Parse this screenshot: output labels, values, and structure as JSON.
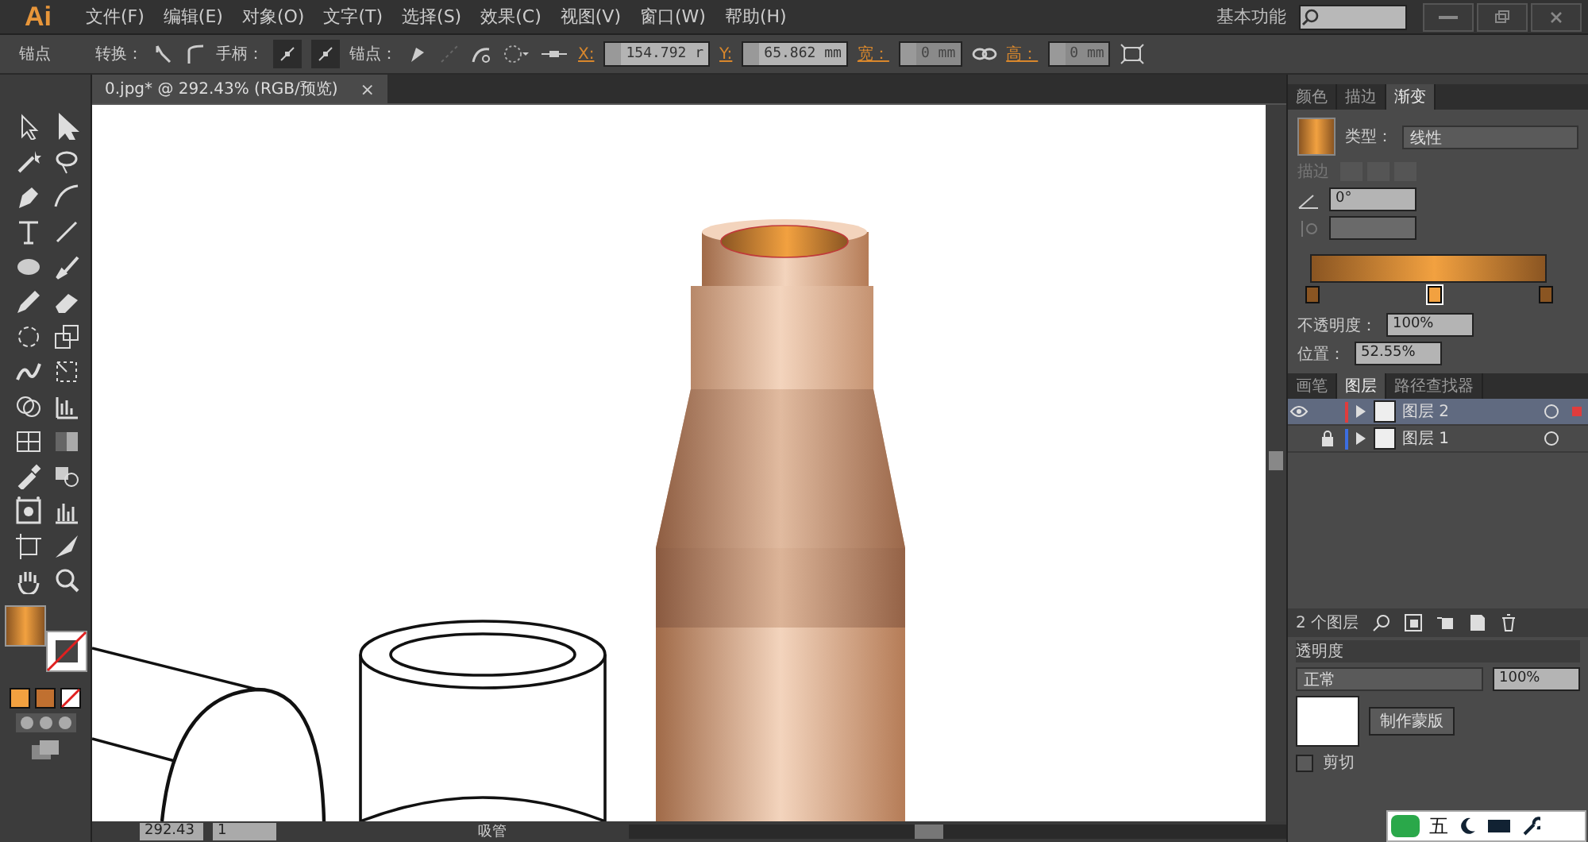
{
  "app": {
    "logo": "Ai",
    "workspace": "基本功能"
  },
  "menu": [
    "文件(F)",
    "编辑(E)",
    "对象(O)",
    "文字(T)",
    "选择(S)",
    "效果(C)",
    "视图(V)",
    "窗口(W)",
    "帮助(H)"
  ],
  "control_bar": {
    "label": "锚点",
    "convert_label": "转换：",
    "handles_label": "手柄：",
    "anchor_label": "锚点：",
    "x_label": "X:",
    "x_value": "154.792 r",
    "y_label": "Y:",
    "y_value": "65.862 mm",
    "w_label": "宽：",
    "w_value": "0 mm",
    "h_label": "高：",
    "h_value": "0 mm"
  },
  "document_tab": {
    "title": "0.jpg* @ 292.43% (RGB/预览)",
    "close": "×"
  },
  "status_bar": {
    "zoom": "292.43",
    "page": "1",
    "tool": "吸管"
  },
  "gradient_panel": {
    "tabs": [
      {
        "label": "颜色",
        "selected": false
      },
      {
        "label": "描边",
        "selected": false
      },
      {
        "label": "渐变",
        "selected": true
      }
    ],
    "type_label": "类型：",
    "type_value": "线性",
    "stroke_label": "描边",
    "angle_value": "0°",
    "stops": [
      {
        "level": 0,
        "color": "#8a5522",
        "selected": false
      },
      {
        "level": 0.5255,
        "color": "#f2a140",
        "selected": true
      },
      {
        "level": 1,
        "color": "#8a5522",
        "selected": false
      }
    ],
    "opacity_label": "不透明度：",
    "opacity_value": "100%",
    "position_label": "位置：",
    "position_value": "52.55%"
  },
  "layers_panel": {
    "tabs": [
      {
        "label": "画笔",
        "selected": false
      },
      {
        "label": "图层",
        "selected": true
      },
      {
        "label": "路径查找器",
        "selected": false
      }
    ],
    "layers": [
      {
        "name": "图层 2",
        "visible": true,
        "locked": false,
        "color": "#e03c3c",
        "selected": true
      },
      {
        "name": "图层 1",
        "visible": false,
        "locked": true,
        "color": "#3c6ee0",
        "selected": false
      }
    ],
    "count": "2 个图层"
  },
  "transparency_panel": {
    "title": "透明度",
    "blend": "正常",
    "opacity": "100%",
    "mask_button": "制作蒙版",
    "clip_label": "剪切",
    "clip_checked": false
  },
  "ime_bar": {
    "mode": "五"
  }
}
